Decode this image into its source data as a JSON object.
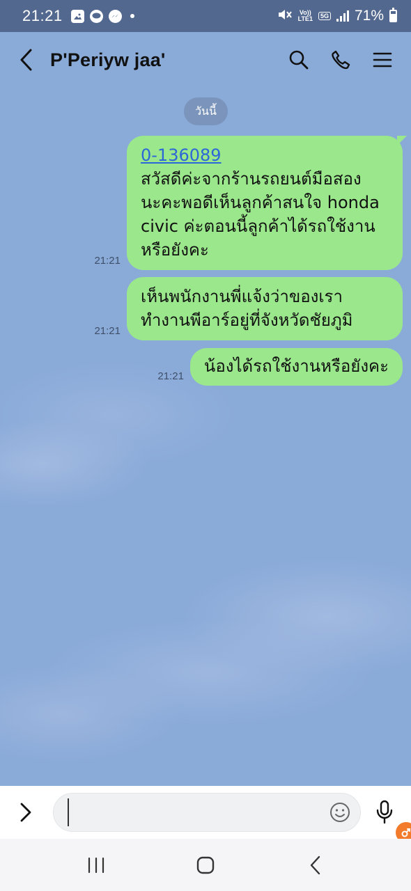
{
  "status_bar": {
    "time": "21:21",
    "volte_label": "Vo))",
    "lte_label": "LTE1",
    "network": "5G",
    "battery": "71%",
    "battery_level": 0.71
  },
  "header": {
    "title": "P'Periyw jaa'",
    "icons": [
      "back-icon",
      "search-icon",
      "phone-icon",
      "menu-icon"
    ]
  },
  "chat": {
    "date_chip": "วันนี้",
    "messages": [
      {
        "sender": "me",
        "time": "21:21",
        "link": "0-136089",
        "lines": [
          "สวัสดีค่ะจากร้านรถยนต์มือสอง",
          "นะคะพอดีเห็นลูกค้าสนใจ honda",
          "civic ค่ะตอนนี้ลูกค้าได้รถใช้งาน",
          "หรือยังคะ"
        ]
      },
      {
        "sender": "me",
        "time": "21:21",
        "lines": [
          "เห็นพนักงานพี่แจ้งว่าของเรา",
          "ทำงานพีอาร์อยู่ที่จังหวัดชัยภูมิ"
        ]
      },
      {
        "sender": "me",
        "time": "21:21",
        "lines": [
          "น้องได้รถใช้งานหรือยังคะ"
        ]
      }
    ]
  },
  "input_bar": {
    "value": "",
    "placeholder": ""
  },
  "colors": {
    "status_bar": "#53688f",
    "chat_bg": "#8aaad8",
    "bubble_me": "#9be88c",
    "link": "#2c67d8"
  }
}
